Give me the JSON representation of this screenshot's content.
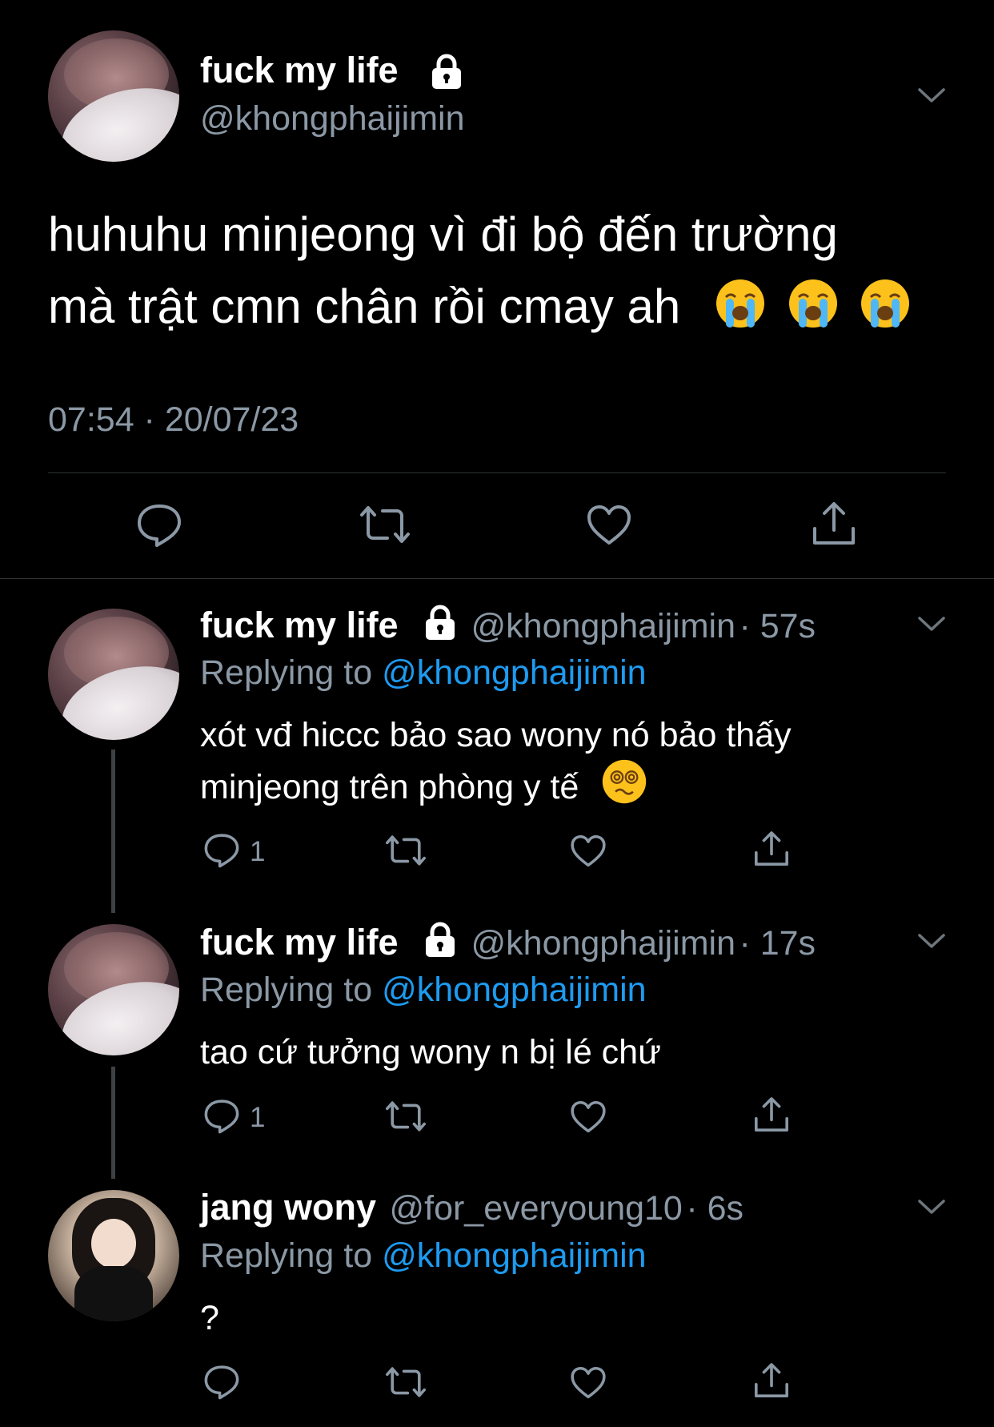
{
  "main_tweet": {
    "display_name": "fuck my life",
    "handle": "@khongphaijimin",
    "text_line1": "huhuhu minjeong vì đi bộ đến trường",
    "text_line2": "mà trật cmn chân rồi cmay ah",
    "emoji": "loudly-crying-face",
    "timestamp": "07:54 · 20/07/23",
    "protected_icon": "lock-icon"
  },
  "replies": [
    {
      "display_name": "fuck my life",
      "handle": "@khongphaijimin",
      "time": "· 57s",
      "replying_prefix": "Replying to",
      "replying_to": "@khongphaijimin",
      "text_line1": "xót vđ hiccc bảo sao wony nó bảo thấy",
      "text_line2": "minjeong trên phòng y tế",
      "emoji": "face-with-spiral-eyes",
      "reply_count": "1"
    },
    {
      "display_name": "fuck my life",
      "handle": "@khongphaijimin",
      "time": "· 17s",
      "replying_prefix": "Replying to",
      "replying_to": "@khongphaijimin",
      "text_line1": "tao cứ tưởng wony n bị lé chứ",
      "reply_count": "1"
    },
    {
      "display_name": "jang wony",
      "handle": "@for_everyoung10",
      "time": "· 6s",
      "replying_prefix": "Replying to",
      "replying_to": "@khongphaijimin",
      "text_line1": "?",
      "reply_count": ""
    }
  ],
  "colors": {
    "background": "#000000",
    "secondary_text": "#8b98a5",
    "link": "#1d9bf0",
    "divider": "#2f3336"
  }
}
